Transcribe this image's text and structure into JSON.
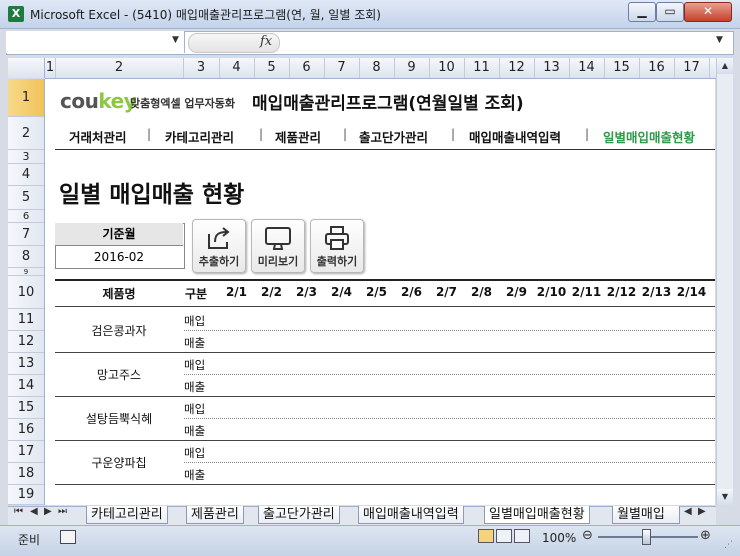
{
  "window": {
    "title": "Microsoft Excel - (5410) 매입매출관리프로그램(연, 월, 일별 조회)",
    "app_icon_letter": "X"
  },
  "formula_bar": {
    "fx_symbol": "fx",
    "value": ""
  },
  "columns": [
    "1",
    "2",
    "3",
    "4",
    "5",
    "6",
    "7",
    "8",
    "9",
    "10",
    "11",
    "12",
    "13",
    "14",
    "15",
    "16",
    "17"
  ],
  "rows": [
    "1",
    "2",
    "3",
    "4",
    "5",
    "6",
    "7",
    "8",
    "9",
    "10",
    "11",
    "12",
    "13",
    "14",
    "15",
    "16",
    "17",
    "18",
    "19"
  ],
  "header": {
    "logo_main": "cou",
    "logo_accent": "key",
    "logo_slogan": "맞춤형엑셀 업무자동화",
    "program_title": "매입매출관리프로그램(연월일별 조회)"
  },
  "nav": {
    "items": [
      "거래처관리",
      "카테고리관리",
      "제품관리",
      "출고단가관리",
      "매입매출내역입력",
      "일별매입매출현황"
    ],
    "separator": "|",
    "active_color": "#2e9a48"
  },
  "page_title": "일별 매입매출 현황",
  "base_month": {
    "label": "기준월",
    "value": "2016-02"
  },
  "actions": {
    "extract_label": "추출하기",
    "preview_label": "미리보기",
    "print_label": "출력하기"
  },
  "table": {
    "product_header": "제품명",
    "type_header": "구분",
    "dates": [
      "2/1",
      "2/2",
      "2/3",
      "2/4",
      "2/5",
      "2/6",
      "2/7",
      "2/8",
      "2/9",
      "2/10",
      "2/11",
      "2/12",
      "2/13",
      "2/14"
    ],
    "products": [
      {
        "name": "검은콩과자",
        "types": [
          "매입",
          "매출"
        ]
      },
      {
        "name": "망고주스",
        "types": [
          "매입",
          "매출"
        ]
      },
      {
        "name": "설탕듬뿍식혜",
        "types": [
          "매입",
          "매출"
        ]
      },
      {
        "name": "구운양파칩",
        "types": [
          "매입",
          "매출"
        ]
      }
    ]
  },
  "sheet_tabs": {
    "items": [
      "카테고리관리",
      "제품관리",
      "출고단가관리",
      "매입매출내역입력",
      "일별매입매출현황",
      "월별매입"
    ]
  },
  "status": {
    "ready": "준비",
    "zoom": "100%"
  }
}
